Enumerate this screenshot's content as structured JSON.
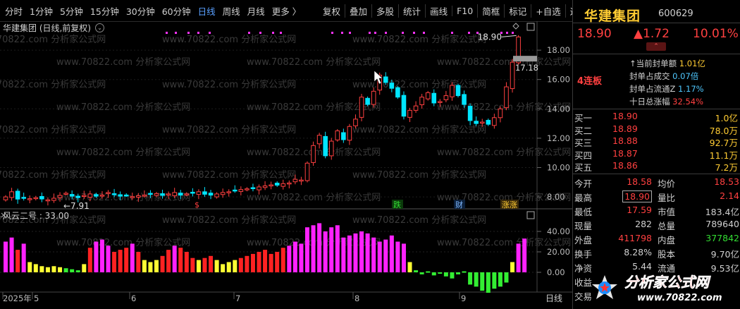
{
  "toolbar": {
    "periods": [
      "分时",
      "1分钟",
      "5分钟",
      "15分钟",
      "30分钟",
      "60分钟",
      "日线",
      "周线",
      "月线",
      "更多 〉"
    ],
    "active_period": "日线",
    "tools": [
      "复权",
      "叠加",
      "多股",
      "统计",
      "画线",
      "F10",
      "简框",
      "标记",
      "+自选",
      "返回"
    ]
  },
  "chart": {
    "title": "华建集团 (日线,前复权)",
    "high_marker": "18.90",
    "low_marker": "7.91",
    "current_tag": "17.18",
    "y_ticks": [
      "18.00",
      "16.00",
      "14.00",
      "12.00",
      "10.00",
      "8.00"
    ],
    "event_labels": [
      "$",
      "跌",
      "财",
      "涨"
    ],
    "indicator_label": "风云二号 : 33.00",
    "indicator_ticks": [
      "40.00",
      "20.00",
      "0.00"
    ],
    "x_labels": [
      "2025年",
      "5",
      "6",
      "7",
      "8",
      "9"
    ],
    "x_right_label": "日线"
  },
  "watermark_text": "www.70822.com 分析家公式网",
  "panel": {
    "name": "华建集团",
    "code": "600629",
    "price": "18.90",
    "change": "▲1.72",
    "change_pct": "10.01%",
    "limit_badge": "4连板",
    "stats": [
      {
        "label": "当前封单额",
        "value": "1.01亿",
        "color": "#ffcc33"
      },
      {
        "label": "封单占成交",
        "value": "0.07倍",
        "color": "#4fc8ff"
      },
      {
        "label": "封单占流通Z",
        "value": "1.17%",
        "color": "#4fc8ff"
      },
      {
        "label": "十日总涨幅",
        "value": "32.54%",
        "color": "#ff4040"
      }
    ],
    "order_book": [
      {
        "label": "买一",
        "price": "18.90",
        "vol": "1.0亿"
      },
      {
        "label": "买二",
        "price": "18.89",
        "vol": "78.0万"
      },
      {
        "label": "买三",
        "price": "18.88",
        "vol": "92.7万"
      },
      {
        "label": "买四",
        "price": "18.87",
        "vol": "11.1万"
      },
      {
        "label": "买五",
        "price": "18.86",
        "vol": "7.2万"
      }
    ],
    "quotes": [
      {
        "l1": "今开",
        "v1": "18.58",
        "c1": "#ff4040",
        "l2": "均价",
        "v2": "18.53",
        "c2": "#ff4040"
      },
      {
        "l1": "最高",
        "v1": "18.90",
        "c1": "#ff4040",
        "l2": "量比",
        "v2": "2.14",
        "c2": "#ff4040"
      },
      {
        "l1": "最低",
        "v1": "17.59",
        "c1": "#ff4040",
        "l2": "市值",
        "v2": "183.4亿",
        "c2": "#d0d0d0"
      },
      {
        "l1": "现量",
        "v1": "282",
        "c1": "#d0d0d0",
        "l2": "总量",
        "v2": "789640",
        "c2": "#d0d0d0"
      },
      {
        "l1": "外盘",
        "v1": "411798",
        "c1": "#ff4040",
        "l2": "内盘",
        "v2": "377842",
        "c2": "#33dd33"
      },
      {
        "l1": "换手",
        "v1": "8.28%",
        "c1": "#d0d0d0",
        "l2": "股本",
        "v2": "9.70亿",
        "c2": "#d0d0d0"
      },
      {
        "l1": "净资",
        "v1": "5.44",
        "c1": "#d0d0d0",
        "l2": "流通",
        "v2": "9.53亿",
        "c2": "#d0d0d0"
      },
      {
        "l1": "收益",
        "v1": "",
        "c1": "#d0d0d0",
        "l2": "",
        "v2": "",
        "c2": "#d0d0d0"
      },
      {
        "l1": "交易",
        "v1": "",
        "c1": "#d0d0d0",
        "l2": "",
        "v2": "",
        "c2": "#d0d0d0"
      }
    ]
  },
  "logo": {
    "text": "分析家公式网",
    "url": "www.70822.com"
  },
  "colors": {
    "up": "#ff4040",
    "down": "#00e5ff",
    "accent": "#ffcc33",
    "active": "#5aa0ff"
  }
}
